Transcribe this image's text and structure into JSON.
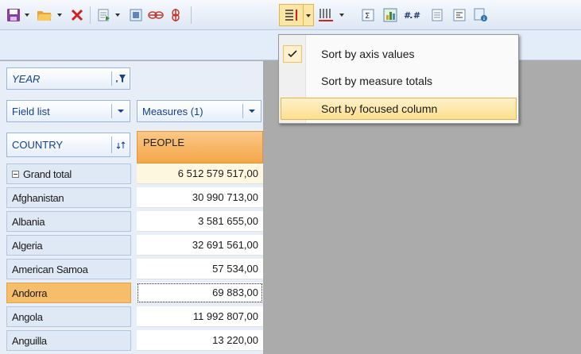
{
  "toolbar": {
    "icons": [
      "save-icon",
      "open-icon",
      "delete-icon",
      "export-icon",
      "format-icon",
      "link-icon",
      "sigma-icon",
      "sort-by-axis-icon",
      "columns-icon",
      "totals-icon",
      "chart-icon",
      "number-format-icon",
      "table-icon",
      "properties-icon",
      "info-icon"
    ],
    "accent": "#fde6a4"
  },
  "filters": {
    "year_label": "YEAR",
    "field_list_label": "Field list",
    "measures_label": "Measures (1)",
    "country_label": "COUNTRY"
  },
  "grid": {
    "column_header": "PEOPLE",
    "rows": [
      {
        "label": "Grand total",
        "value": "6 512 579 517,00"
      },
      {
        "label": "Afghanistan",
        "value": "30 990 713,00"
      },
      {
        "label": "Albania",
        "value": "3 581 655,00"
      },
      {
        "label": "Algeria",
        "value": "32 691 561,00"
      },
      {
        "label": "American Samoa",
        "value": "57 534,00"
      },
      {
        "label": "Andorra",
        "value": "69 883,00"
      },
      {
        "label": "Angola",
        "value": "11 992 807,00"
      },
      {
        "label": "Anguilla",
        "value": "13 220,00"
      }
    ]
  },
  "menu": {
    "items": [
      {
        "label": "Sort by axis values",
        "checked": true
      },
      {
        "label": "Sort by measure totals",
        "checked": false
      },
      {
        "label": "Sort by focused column",
        "checked": false
      }
    ]
  }
}
